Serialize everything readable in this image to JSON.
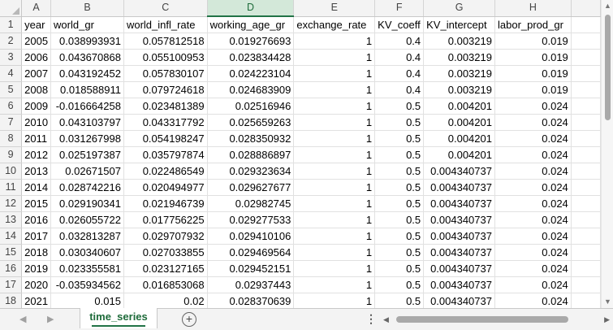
{
  "sheet": {
    "columns": [
      "A",
      "B",
      "C",
      "D",
      "E",
      "F",
      "G",
      "H"
    ],
    "selected_column": "D",
    "row_numbers": [
      1,
      2,
      3,
      4,
      5,
      6,
      7,
      8,
      9,
      10,
      11,
      12,
      13,
      14,
      15,
      16,
      17,
      18
    ],
    "rows": [
      [
        "year",
        "world_gr",
        "world_infl_rate",
        "working_age_gr",
        "exchange_rate",
        "KV_coeff",
        "KV_intercept",
        "labor_prod_gr"
      ],
      [
        "2005",
        "0.038993931",
        "0.057812518",
        "0.019276693",
        "1",
        "0.4",
        "0.003219",
        "0.019"
      ],
      [
        "2006",
        "0.043670868",
        "0.055100953",
        "0.023834428",
        "1",
        "0.4",
        "0.003219",
        "0.019"
      ],
      [
        "2007",
        "0.043192452",
        "0.057830107",
        "0.024223104",
        "1",
        "0.4",
        "0.003219",
        "0.019"
      ],
      [
        "2008",
        "0.018588911",
        "0.079724618",
        "0.024683909",
        "1",
        "0.4",
        "0.003219",
        "0.019"
      ],
      [
        "2009",
        "-0.016664258",
        "0.023481389",
        "0.02516946",
        "1",
        "0.5",
        "0.004201",
        "0.024"
      ],
      [
        "2010",
        "0.043103797",
        "0.043317792",
        "0.025659263",
        "1",
        "0.5",
        "0.004201",
        "0.024"
      ],
      [
        "2011",
        "0.031267998",
        "0.054198247",
        "0.028350932",
        "1",
        "0.5",
        "0.004201",
        "0.024"
      ],
      [
        "2012",
        "0.025197387",
        "0.035797874",
        "0.028886897",
        "1",
        "0.5",
        "0.004201",
        "0.024"
      ],
      [
        "2013",
        "0.02671507",
        "0.022486549",
        "0.029323634",
        "1",
        "0.5",
        "0.004340737",
        "0.024"
      ],
      [
        "2014",
        "0.028742216",
        "0.020494977",
        "0.029627677",
        "1",
        "0.5",
        "0.004340737",
        "0.024"
      ],
      [
        "2015",
        "0.029190341",
        "0.021946739",
        "0.02982745",
        "1",
        "0.5",
        "0.004340737",
        "0.024"
      ],
      [
        "2016",
        "0.026055722",
        "0.017756225",
        "0.029277533",
        "1",
        "0.5",
        "0.004340737",
        "0.024"
      ],
      [
        "2017",
        "0.032813287",
        "0.029707932",
        "0.029410106",
        "1",
        "0.5",
        "0.004340737",
        "0.024"
      ],
      [
        "2018",
        "0.030340607",
        "0.027033855",
        "0.029469564",
        "1",
        "0.5",
        "0.004340737",
        "0.024"
      ],
      [
        "2019",
        "0.023355581",
        "0.023127165",
        "0.029452151",
        "1",
        "0.5",
        "0.004340737",
        "0.024"
      ],
      [
        "2020",
        "-0.035934562",
        "0.016853068",
        "0.02937443",
        "1",
        "0.5",
        "0.004340737",
        "0.024"
      ],
      [
        "2021",
        "0.015",
        "0.02",
        "0.028370639",
        "1",
        "0.5",
        "0.004340737",
        "0.024"
      ]
    ]
  },
  "tabs": {
    "active_sheet": "time_series",
    "add_sheet_symbol": "+",
    "more_symbol": "⋮"
  },
  "icons": {
    "scroll_up": "▲",
    "scroll_down": "▼",
    "scroll_left": "◀",
    "scroll_right": "▶",
    "sheet_prev": "◀",
    "sheet_next": "▶"
  },
  "colors": {
    "accent": "#217346",
    "selected_header_bg": "#d3e8d9"
  }
}
